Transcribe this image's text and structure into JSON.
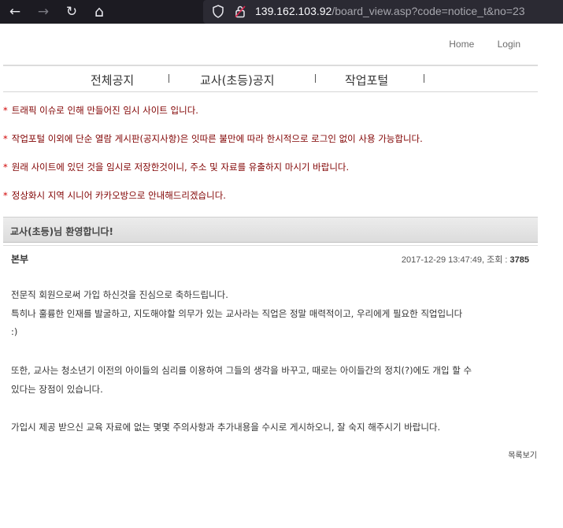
{
  "browser": {
    "back_icon": "←",
    "forward_icon": "→",
    "reload_icon": "↻",
    "home_icon": "⌂",
    "url_host": "139.162.103.92",
    "url_path": "/board_view.asp?code=notice_t&no=23"
  },
  "header": {
    "links": [
      "Home",
      "Login"
    ]
  },
  "main_nav": {
    "items": [
      "전체공지",
      "교사(초등)공지",
      "작업포털"
    ]
  },
  "notices": [
    "트래픽 이슈로 인해 만들어진 임시 사이트 입니다.",
    "작업포털 이외에 단순 열람 게시판(공지사항)은 잇따른 불만에 따라 한시적으로 로그인 없이 사용 가능합니다.",
    "원래 사이트에 있던 것을 임시로 저장한것이니, 주소 및 자료를 유출하지 마시기 바랍니다.",
    "정상화시 지역 시니어 카카오방으로 안내해드리겠습니다."
  ],
  "notice_marker": "*",
  "welcome": "교사(초등)님 환영합니다!",
  "post": {
    "author": "본부",
    "date": "2017-12-29 13:47:49, 조회 : ",
    "views": "3785",
    "lines": [
      "전문직 회원으로써 가입 하신것을 진심으로 축하드립니다.",
      "특히나 훌륭한 인재를 발굴하고, 지도해야할 의무가 있는 교사라는 직업은 정말 매력적이고, 우리에게 필요한 직업입니다",
      ":)",
      "또한, 교사는 청소년기 이전의 아이들의 심리를 이용하여 그들의 생각을 바꾸고, 때로는 아이들간의 정치(?)에도 개입 할 수",
      "있다는 장점이 있습니다.",
      "가입시 제공 받으신 교육 자료에 없는 몇몇 주의사항과 추가내용을 수시로 게시하오니, 잘 숙지 해주시기 바랍니다."
    ]
  },
  "list_button": "목록보기",
  "colors": {
    "notice_text": "#800000",
    "browser_bg": "#1c1b22",
    "url_bg": "#2b2a33"
  }
}
